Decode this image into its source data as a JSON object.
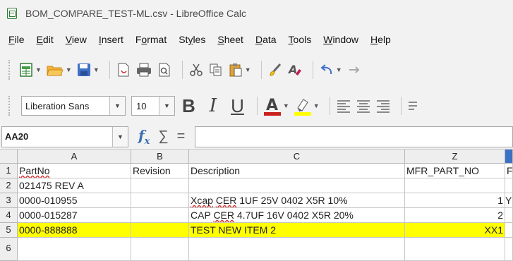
{
  "window": {
    "title": "BOM_COMPARE_TEST-ML.csv - LibreOffice Calc"
  },
  "menu": [
    {
      "pre": "",
      "u": "F",
      "post": "ile"
    },
    {
      "pre": "",
      "u": "E",
      "post": "dit"
    },
    {
      "pre": "",
      "u": "V",
      "post": "iew"
    },
    {
      "pre": "",
      "u": "I",
      "post": "nsert"
    },
    {
      "pre": "F",
      "u": "o",
      "post": "rmat"
    },
    {
      "pre": "St",
      "u": "y",
      "post": "les"
    },
    {
      "pre": "",
      "u": "S",
      "post": "heet"
    },
    {
      "pre": "",
      "u": "D",
      "post": "ata"
    },
    {
      "pre": "",
      "u": "T",
      "post": "ools"
    },
    {
      "pre": "",
      "u": "W",
      "post": "indow"
    },
    {
      "pre": "",
      "u": "H",
      "post": "elp"
    }
  ],
  "format_toolbar": {
    "font_name": "Liberation Sans",
    "font_size": "10",
    "font_color": "#c9211e",
    "highlight_color": "#ffff00"
  },
  "formula_bar": {
    "name_box": "AA20",
    "formula": ""
  },
  "sheet": {
    "columns": [
      "A",
      "B",
      "C",
      "Z"
    ],
    "rows": [
      "1",
      "2",
      "3",
      "4",
      "5",
      "6"
    ],
    "cells": {
      "r1": {
        "a": "PartNo",
        "b": "Revision",
        "c": "Description",
        "z": "MFR_PART_NO",
        "extra": "F"
      },
      "r2": {
        "a": "021475 REV A",
        "b": "",
        "c": "",
        "z": "",
        "extra": ""
      },
      "r3": {
        "a": "0000-010955",
        "b": "",
        "c_word1": "Xcap",
        "c_word2": "CER",
        "c_rest": "1UF 25V 0402 X5R 10%",
        "z": "1",
        "extra": "Y"
      },
      "r4": {
        "a": "0000-015287",
        "b": "",
        "c_pre": "CAP",
        "c_word": "CER",
        "c_rest": "4.7UF 16V 0402 X5R 20%",
        "z": "2",
        "extra": ""
      },
      "r5": {
        "a": "0000-888888",
        "b": "",
        "c": "TEST NEW ITEM 2",
        "z": "XX1",
        "extra": ""
      }
    },
    "highlight_color": "#ffff00"
  }
}
